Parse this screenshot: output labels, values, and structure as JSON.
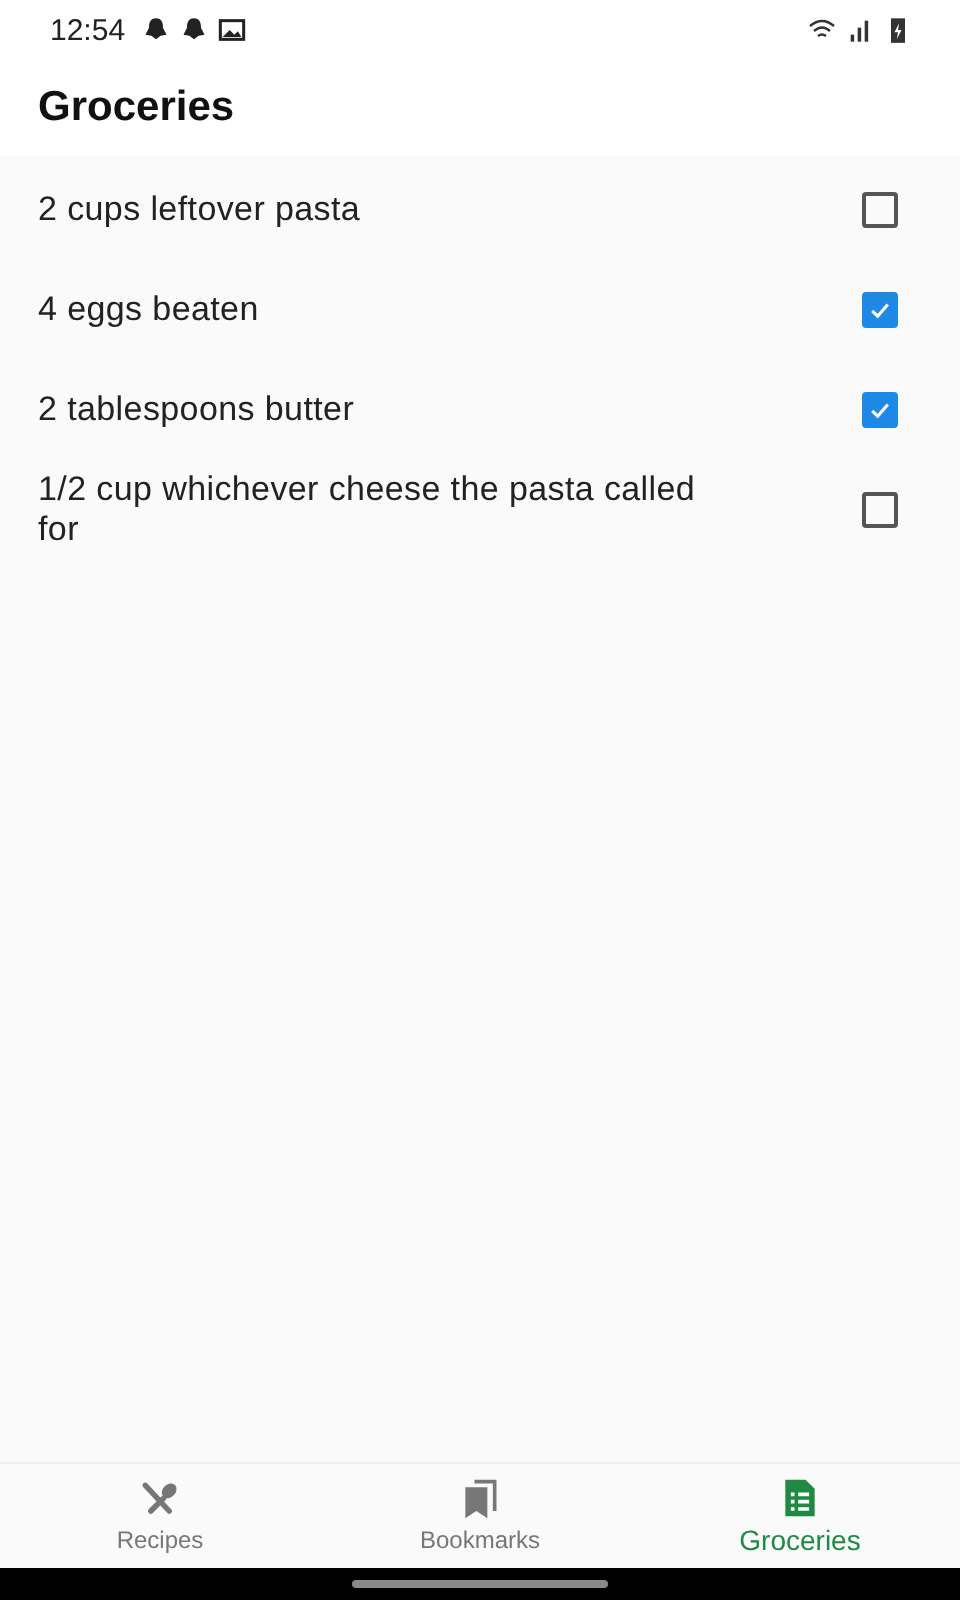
{
  "status_bar": {
    "time": "12:54"
  },
  "title": "Groceries",
  "items": [
    {
      "text": "2 cups leftover pasta",
      "checked": false
    },
    {
      "text": "4 eggs beaten",
      "checked": true
    },
    {
      "text": "2 tablespoons butter",
      "checked": true
    },
    {
      "text": "1/2 cup whichever cheese the pasta called for",
      "checked": false
    }
  ],
  "nav": [
    {
      "label": "Recipes",
      "kind": "recipes",
      "selected": false
    },
    {
      "label": "Bookmarks",
      "kind": "bookmarks",
      "selected": false
    },
    {
      "label": "Groceries",
      "kind": "groceries",
      "selected": true
    }
  ]
}
